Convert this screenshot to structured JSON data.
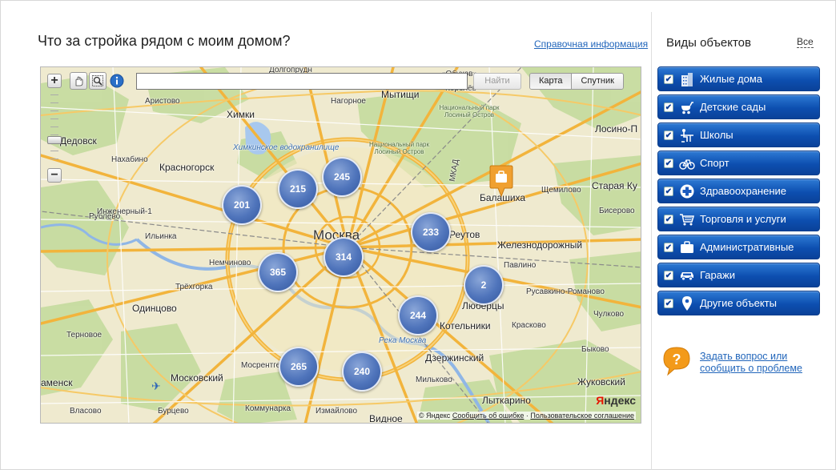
{
  "page": {
    "title": "Что за стройка рядом с моим домом?",
    "help_link": "Справочная информация"
  },
  "map": {
    "search_placeholder": "",
    "find_label": "Найти",
    "layers": [
      "Карта",
      "Спутник"
    ],
    "active_layer": "Карта",
    "zoom_in": "+",
    "zoom_out": "−",
    "zoom_level_fraction": 0.62,
    "clusters": [
      "201",
      "215",
      "245",
      "233",
      "314",
      "365",
      "2",
      "244",
      "265",
      "240"
    ],
    "labels": {
      "moskva": "Москва",
      "mytishchi": "Мытищи",
      "korolev": "Королёв",
      "khimki": "Химки",
      "dedovsk": "Дедовск",
      "krasnogorsk": "Красногорск",
      "balashikha": "Балашиха",
      "staraya_kupavna": "Старая Ку",
      "losino": "Лосино-П",
      "reutov": "Реутов",
      "zheleznodorozhny": "Железнодорожный",
      "lyubertsy": "Люберцы",
      "kotelniki": "Котельники",
      "odintsovo": "Одинцово",
      "dzerzhinsky": "Дзержинский",
      "moskovsky": "Московский",
      "zhukovsky": "Жуковский",
      "lytkarino": "Лыткарино",
      "vidnoe": "Видное",
      "znamensk": "аменск",
      "aristovo": "Аристово",
      "nagornoe": "Нагорное",
      "dolgoprudny": "Долгопрудн",
      "obukhovo": "«Обухов»",
      "khimki_reservoir": "Химкинское водохранилище",
      "moskva_river": "Река Москва",
      "np_losiny_1": "Национальный парк Лосиный Остров",
      "np_losiny_2": "Национальный парк Лосиный Остров",
      "mkad": "МКАД",
      "shchemilovo": "Щемилово",
      "biserovo": "Бисерово",
      "pavlino": "Павлино",
      "rusavkino": "Русавкино-Романово",
      "krasnogorsk_small": "Нахабино",
      "rublevo": "Рублёво",
      "inzhenerny": "Инженерный-1",
      "ilinsky": "Ильинка",
      "nemchinovo": "Немчиново",
      "tekhnosad": "Трёхгорка",
      "ternovoe": "Терновое",
      "vlasovo": "Власово",
      "burtsevo": "Бурцево",
      "kommunarka": "Коммунарка",
      "izmaylovo": "Измайлово",
      "milkovo": "Мильково",
      "mosrentgen": "Мосрентген",
      "kraskovo": "Красково",
      "bykovo": "Быково",
      "chulkovo": "Чулково"
    },
    "logo": {
      "y": "Я",
      "rest": "ндекс"
    },
    "copyright": {
      "brand": "© Яндекс",
      "report_error": "Сообщить об ошибке",
      "agreement": "Пользовательское соглашение"
    }
  },
  "sidebar": {
    "title": "Виды объектов",
    "all_label": "Все",
    "categories": [
      {
        "label": "Жилые дома",
        "icon": "building-icon",
        "checked": true
      },
      {
        "label": "Детские сады",
        "icon": "stroller-icon",
        "checked": true
      },
      {
        "label": "Школы",
        "icon": "school-desk-icon",
        "checked": true
      },
      {
        "label": "Спорт",
        "icon": "bicycle-icon",
        "checked": true
      },
      {
        "label": "Здравоохранение",
        "icon": "medical-cross-icon",
        "checked": true
      },
      {
        "label": "Торговля и услуги",
        "icon": "shopping-cart-icon",
        "checked": true
      },
      {
        "label": "Административные",
        "icon": "briefcase-icon",
        "checked": true
      },
      {
        "label": "Гаражи",
        "icon": "car-icon",
        "checked": true
      },
      {
        "label": "Другие объекты",
        "icon": "map-pin-icon",
        "checked": true
      }
    ],
    "ask": {
      "line1": "Задать вопрос или",
      "line2": "сообщить о проблеме"
    }
  },
  "colors": {
    "accent_blue": "#0d4fb0",
    "link_blue": "#2266bb",
    "cluster_blue": "#4f74bb",
    "pin_orange": "#f0a030"
  }
}
